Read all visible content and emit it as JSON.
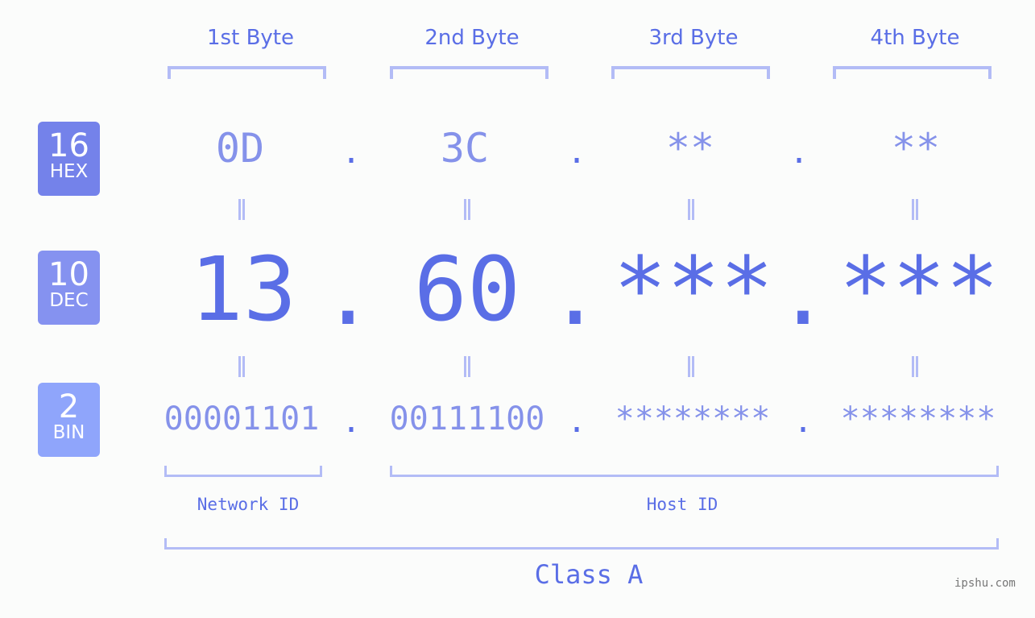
{
  "byte_headers": [
    "1st Byte",
    "2nd Byte",
    "3rd Byte",
    "4th Byte"
  ],
  "badges": [
    {
      "num": "16",
      "label": "HEX",
      "color": "#7482ea"
    },
    {
      "num": "10",
      "label": "DEC",
      "color": "#8592f0"
    },
    {
      "num": "2",
      "label": "BIN",
      "color": "#8fa5fb"
    }
  ],
  "hex": [
    "0D",
    "3C",
    "**",
    "**"
  ],
  "dec": [
    "13",
    "60",
    "***",
    "***"
  ],
  "bin": [
    "00001101",
    "00111100",
    "********",
    "********"
  ],
  "separator": ".",
  "sections": {
    "network": "Network ID",
    "host": "Host ID",
    "class": "Class A"
  },
  "watermark": "ipshu.com",
  "colors": {
    "accent": "#5a6ee6",
    "light": "#8592ea",
    "bracket": "#b3bcf6",
    "background": "#fbfcfb"
  }
}
